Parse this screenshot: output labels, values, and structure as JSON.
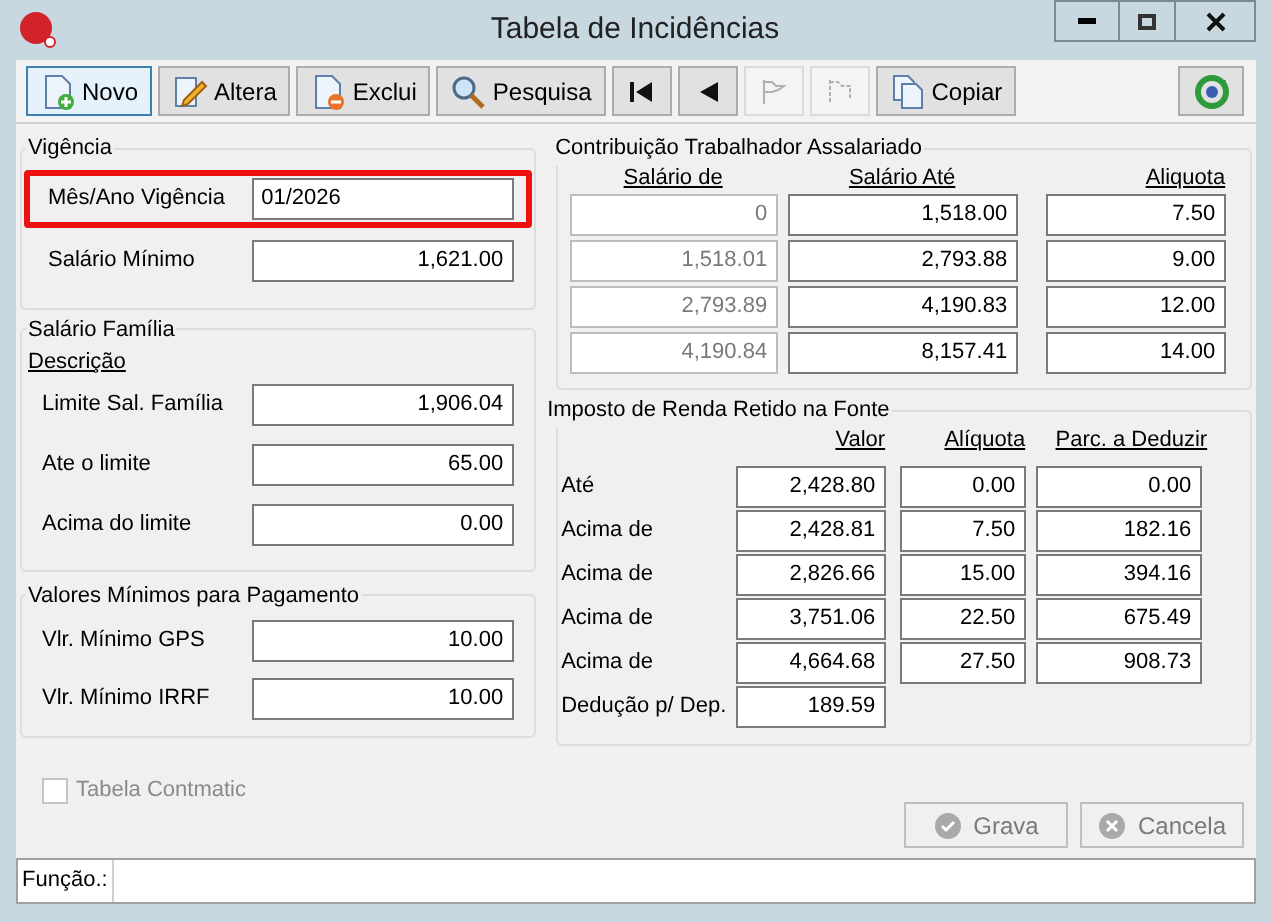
{
  "window": {
    "title": "Tabela de Incidências"
  },
  "toolbar": [
    {
      "kind": "text",
      "label": "Novo",
      "focused": true,
      "disabled": false
    },
    {
      "kind": "text",
      "label": "Altera",
      "focused": false,
      "disabled": false
    },
    {
      "kind": "text",
      "label": "Exclui",
      "focused": false,
      "disabled": false
    },
    {
      "kind": "text",
      "label": "Pesquisa",
      "focused": false,
      "disabled": false
    },
    {
      "kind": "icon",
      "focused": false,
      "disabled": false
    },
    {
      "kind": "icon",
      "focused": false,
      "disabled": false
    },
    {
      "kind": "icon",
      "focused": false,
      "disabled": true
    },
    {
      "kind": "icon",
      "focused": false,
      "disabled": true
    },
    {
      "kind": "text",
      "label": "Copiar",
      "focused": false,
      "disabled": false
    }
  ],
  "vigencia": {
    "title": "Vigência",
    "fields": [
      {
        "label": "Mês/Ano Vigência",
        "value": "01/2026",
        "highlighted": true
      },
      {
        "label": "Salário Mínimo",
        "value": "1,621.00",
        "highlighted": false
      }
    ]
  },
  "salario_familia": {
    "title": "Salário Família",
    "subtitle": "Descrição",
    "fields": [
      {
        "label": "Limite Sal. Família",
        "value": "1,906.04"
      },
      {
        "label": "Ate o limite",
        "value": "65.00"
      },
      {
        "label": "Acima do limite",
        "value": "0.00"
      }
    ]
  },
  "valores_minimos": {
    "title": "Valores Mínimos para Pagamento",
    "fields": [
      {
        "label": "Vlr. Mínimo GPS",
        "value": "10.00"
      },
      {
        "label": "Vlr. Mínimo IRRF",
        "value": "10.00"
      }
    ]
  },
  "contribuicao": {
    "title": "Contribuição Trabalhador Assalariado",
    "columns": [
      "Salário de",
      "Salário Até",
      "Aliquota"
    ],
    "rows": [
      {
        "from": "0",
        "to": "1,518.00",
        "rate": "7.50",
        "from_disabled": true
      },
      {
        "from": "1,518.01",
        "to": "2,793.88",
        "rate": "9.00",
        "from_disabled": true
      },
      {
        "from": "2,793.89",
        "to": "4,190.83",
        "rate": "12.00",
        "from_disabled": true
      },
      {
        "from": "4,190.84",
        "to": "8,157.41",
        "rate": "14.00",
        "from_disabled": true
      }
    ]
  },
  "irrf": {
    "title": "Imposto de Renda Retido na Fonte",
    "columns": [
      "Valor",
      "Alíquota",
      "Parc. a Deduzir"
    ],
    "rows": [
      {
        "label": "Até",
        "value": "2,428.80",
        "rate": "0.00",
        "deduct": "0.00"
      },
      {
        "label": "Acima de",
        "value": "2,428.81",
        "rate": "7.50",
        "deduct": "182.16"
      },
      {
        "label": "Acima de",
        "value": "2,826.66",
        "rate": "15.00",
        "deduct": "394.16"
      },
      {
        "label": "Acima de",
        "value": "3,751.06",
        "rate": "22.50",
        "deduct": "675.49"
      },
      {
        "label": "Acima de",
        "value": "4,664.68",
        "rate": "27.50",
        "deduct": "908.73"
      }
    ],
    "dependent": {
      "label": "Dedução p/ Dep.",
      "value": "189.59"
    }
  },
  "checkbox": {
    "label": "Tabela Contmatic",
    "checked": false,
    "disabled": true
  },
  "buttons": [
    {
      "label": "Grava",
      "disabled": true
    },
    {
      "label": "Cancela",
      "disabled": true
    }
  ],
  "status_bar": {
    "label": "Função.:"
  }
}
